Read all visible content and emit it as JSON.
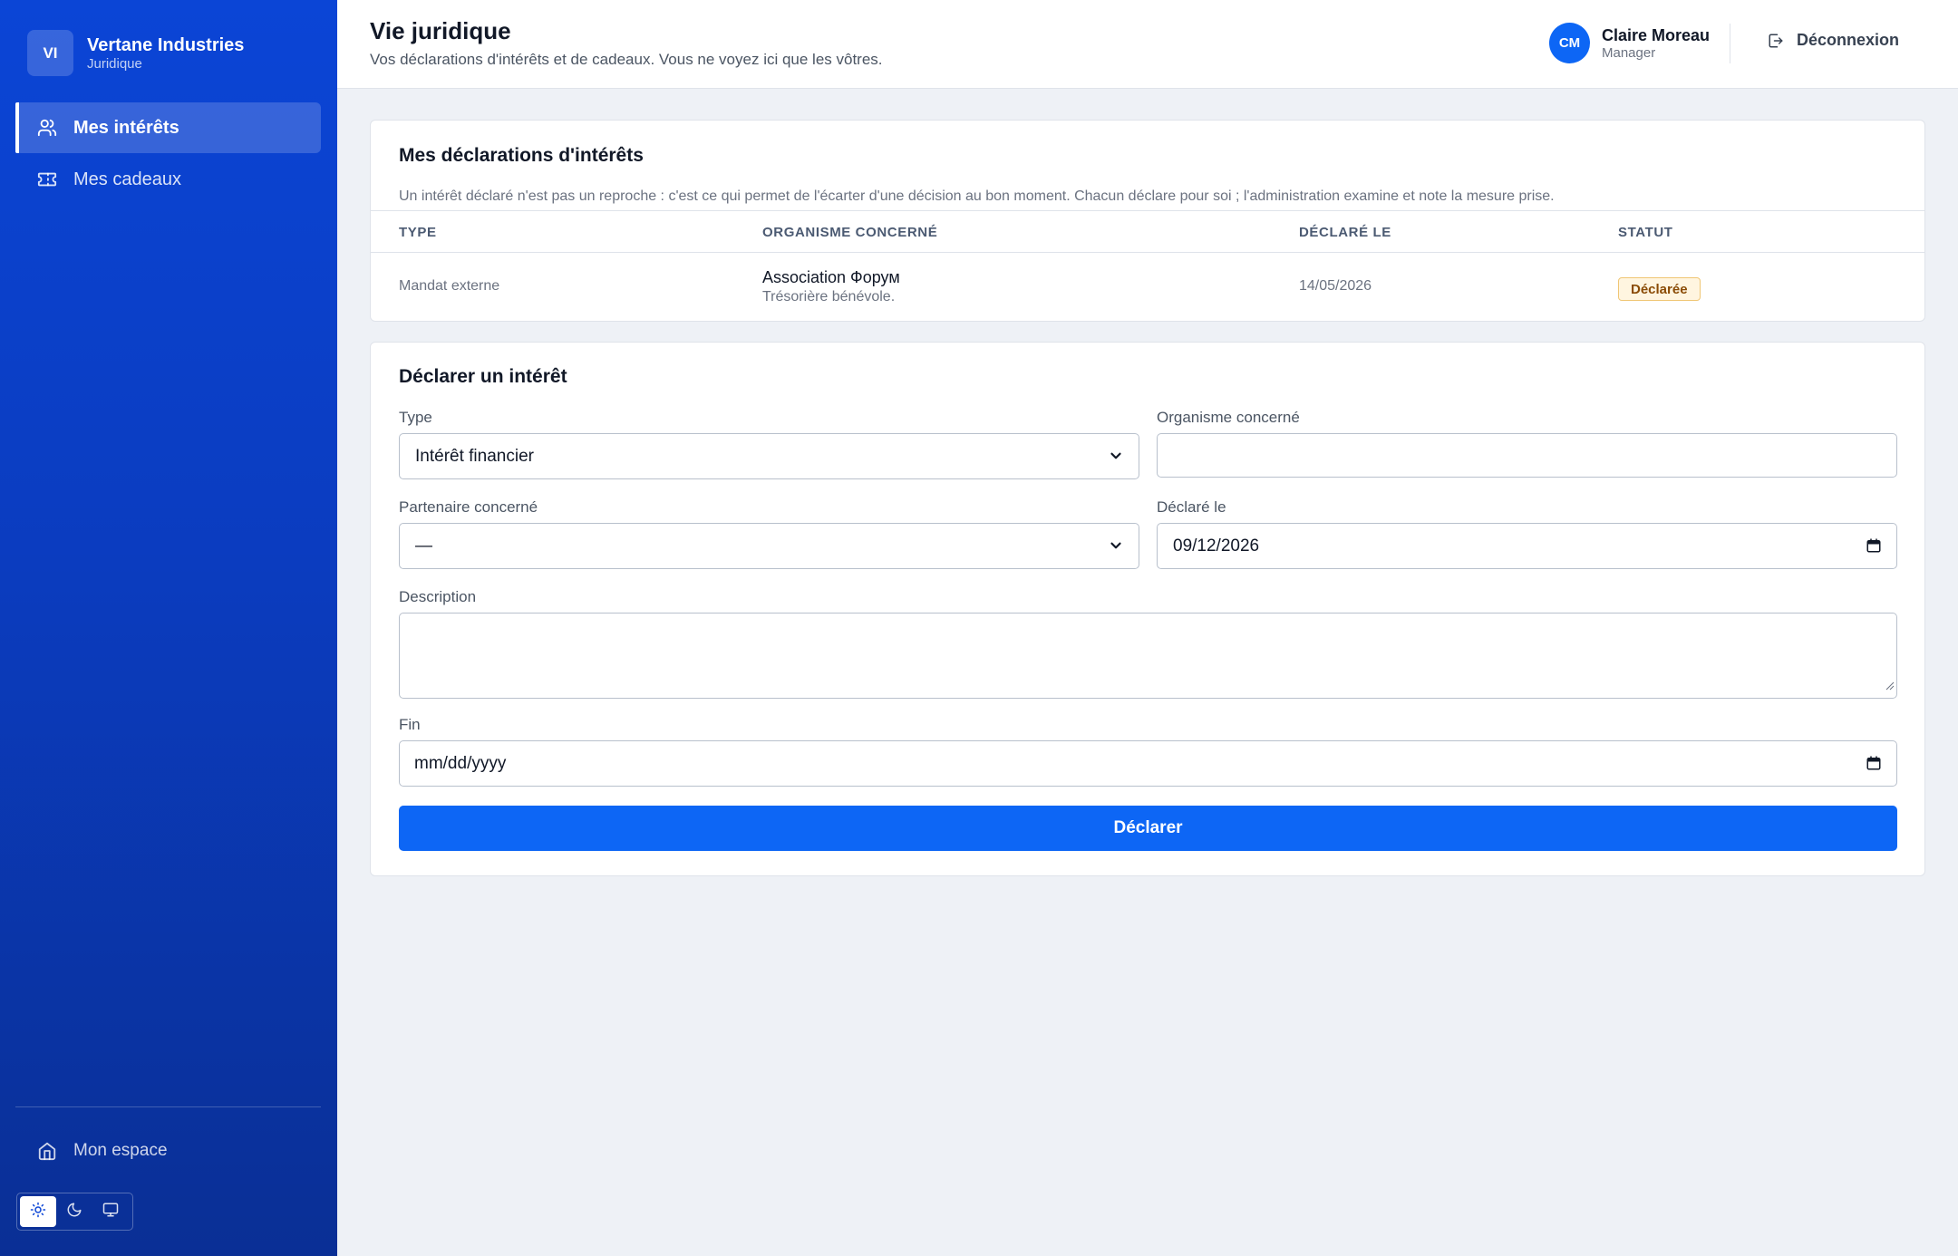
{
  "app": {
    "logo_initials": "VI",
    "name": "Vertane Industries",
    "section": "Juridique"
  },
  "sidebar": {
    "items": [
      {
        "label": "Mes intérêts",
        "icon": "users-icon",
        "active": true
      },
      {
        "label": "Mes cadeaux",
        "icon": "ticket-icon",
        "active": false
      }
    ],
    "home_label": "Mon espace",
    "theme_options": [
      "light",
      "dark",
      "system"
    ],
    "theme_selected": "light"
  },
  "header": {
    "title": "Vie juridique",
    "subtitle": "Vos déclarations d'intérêts et de cadeaux. Vous ne voyez ici que les vôtres.",
    "user": {
      "initials": "CM",
      "name": "Claire Moreau",
      "role": "Manager"
    },
    "logout_label": "Déconnexion"
  },
  "declarations": {
    "title": "Mes déclarations d'intérêts",
    "description": "Un intérêt déclaré n'est pas un reproche : c'est ce qui permet de l'écarter d'une décision au bon moment. Chacun déclare pour soi ; l'administration examine et note la mesure prise.",
    "columns": [
      "Type",
      "Organisme concerné",
      "Déclaré le",
      "Statut"
    ],
    "rows": [
      {
        "type": "Mandat externe",
        "organism": "Association Форум",
        "organism_note": "Trésorière bénévole.",
        "declared_on": "14/05/2026",
        "status": "Déclarée"
      }
    ]
  },
  "form": {
    "title": "Déclarer un intérêt",
    "type_label": "Type",
    "type_value": "Intérêt financier",
    "organism_label": "Organisme concerné",
    "organism_value": "",
    "partner_label": "Partenaire concerné",
    "partner_value": "—",
    "declared_label": "Déclaré le",
    "declared_value": "09/12/2026",
    "description_label": "Description",
    "description_value": "",
    "end_label": "Fin",
    "end_placeholder": "mm/dd/yyyy",
    "submit_label": "Déclarer"
  }
}
